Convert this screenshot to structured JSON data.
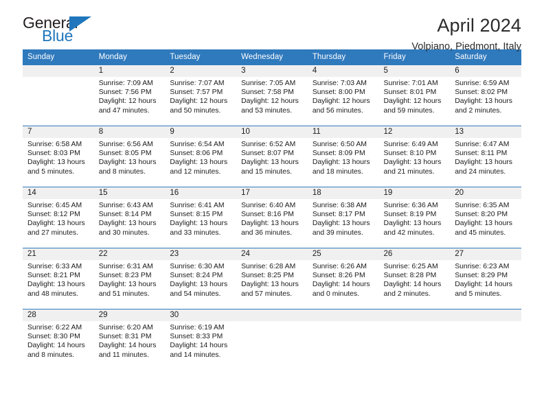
{
  "brand": {
    "name_top": "General",
    "name_bottom": "Blue",
    "triangle_color": "#1f76bc"
  },
  "header": {
    "title": "April 2024",
    "subtitle": "Volpiano, Piedmont, Italy"
  },
  "theme": {
    "header_blue": "#2f79bd",
    "daynum_band": "#f0f0f0",
    "text": "#1a1a1a"
  },
  "calendar": {
    "weekday_headers": [
      "Sunday",
      "Monday",
      "Tuesday",
      "Wednesday",
      "Thursday",
      "Friday",
      "Saturday"
    ],
    "labels": {
      "sunrise": "Sunrise:",
      "sunset": "Sunset:",
      "daylight": "Daylight:"
    },
    "weeks": [
      [
        {
          "day": "",
          "sunrise": "",
          "sunset": "",
          "daylight": ""
        },
        {
          "day": "1",
          "sunrise": "Sunrise: 7:09 AM",
          "sunset": "Sunset: 7:56 PM",
          "daylight": "Daylight: 12 hours and 47 minutes."
        },
        {
          "day": "2",
          "sunrise": "Sunrise: 7:07 AM",
          "sunset": "Sunset: 7:57 PM",
          "daylight": "Daylight: 12 hours and 50 minutes."
        },
        {
          "day": "3",
          "sunrise": "Sunrise: 7:05 AM",
          "sunset": "Sunset: 7:58 PM",
          "daylight": "Daylight: 12 hours and 53 minutes."
        },
        {
          "day": "4",
          "sunrise": "Sunrise: 7:03 AM",
          "sunset": "Sunset: 8:00 PM",
          "daylight": "Daylight: 12 hours and 56 minutes."
        },
        {
          "day": "5",
          "sunrise": "Sunrise: 7:01 AM",
          "sunset": "Sunset: 8:01 PM",
          "daylight": "Daylight: 12 hours and 59 minutes."
        },
        {
          "day": "6",
          "sunrise": "Sunrise: 6:59 AM",
          "sunset": "Sunset: 8:02 PM",
          "daylight": "Daylight: 13 hours and 2 minutes."
        }
      ],
      [
        {
          "day": "7",
          "sunrise": "Sunrise: 6:58 AM",
          "sunset": "Sunset: 8:03 PM",
          "daylight": "Daylight: 13 hours and 5 minutes."
        },
        {
          "day": "8",
          "sunrise": "Sunrise: 6:56 AM",
          "sunset": "Sunset: 8:05 PM",
          "daylight": "Daylight: 13 hours and 8 minutes."
        },
        {
          "day": "9",
          "sunrise": "Sunrise: 6:54 AM",
          "sunset": "Sunset: 8:06 PM",
          "daylight": "Daylight: 13 hours and 12 minutes."
        },
        {
          "day": "10",
          "sunrise": "Sunrise: 6:52 AM",
          "sunset": "Sunset: 8:07 PM",
          "daylight": "Daylight: 13 hours and 15 minutes."
        },
        {
          "day": "11",
          "sunrise": "Sunrise: 6:50 AM",
          "sunset": "Sunset: 8:09 PM",
          "daylight": "Daylight: 13 hours and 18 minutes."
        },
        {
          "day": "12",
          "sunrise": "Sunrise: 6:49 AM",
          "sunset": "Sunset: 8:10 PM",
          "daylight": "Daylight: 13 hours and 21 minutes."
        },
        {
          "day": "13",
          "sunrise": "Sunrise: 6:47 AM",
          "sunset": "Sunset: 8:11 PM",
          "daylight": "Daylight: 13 hours and 24 minutes."
        }
      ],
      [
        {
          "day": "14",
          "sunrise": "Sunrise: 6:45 AM",
          "sunset": "Sunset: 8:12 PM",
          "daylight": "Daylight: 13 hours and 27 minutes."
        },
        {
          "day": "15",
          "sunrise": "Sunrise: 6:43 AM",
          "sunset": "Sunset: 8:14 PM",
          "daylight": "Daylight: 13 hours and 30 minutes."
        },
        {
          "day": "16",
          "sunrise": "Sunrise: 6:41 AM",
          "sunset": "Sunset: 8:15 PM",
          "daylight": "Daylight: 13 hours and 33 minutes."
        },
        {
          "day": "17",
          "sunrise": "Sunrise: 6:40 AM",
          "sunset": "Sunset: 8:16 PM",
          "daylight": "Daylight: 13 hours and 36 minutes."
        },
        {
          "day": "18",
          "sunrise": "Sunrise: 6:38 AM",
          "sunset": "Sunset: 8:17 PM",
          "daylight": "Daylight: 13 hours and 39 minutes."
        },
        {
          "day": "19",
          "sunrise": "Sunrise: 6:36 AM",
          "sunset": "Sunset: 8:19 PM",
          "daylight": "Daylight: 13 hours and 42 minutes."
        },
        {
          "day": "20",
          "sunrise": "Sunrise: 6:35 AM",
          "sunset": "Sunset: 8:20 PM",
          "daylight": "Daylight: 13 hours and 45 minutes."
        }
      ],
      [
        {
          "day": "21",
          "sunrise": "Sunrise: 6:33 AM",
          "sunset": "Sunset: 8:21 PM",
          "daylight": "Daylight: 13 hours and 48 minutes."
        },
        {
          "day": "22",
          "sunrise": "Sunrise: 6:31 AM",
          "sunset": "Sunset: 8:23 PM",
          "daylight": "Daylight: 13 hours and 51 minutes."
        },
        {
          "day": "23",
          "sunrise": "Sunrise: 6:30 AM",
          "sunset": "Sunset: 8:24 PM",
          "daylight": "Daylight: 13 hours and 54 minutes."
        },
        {
          "day": "24",
          "sunrise": "Sunrise: 6:28 AM",
          "sunset": "Sunset: 8:25 PM",
          "daylight": "Daylight: 13 hours and 57 minutes."
        },
        {
          "day": "25",
          "sunrise": "Sunrise: 6:26 AM",
          "sunset": "Sunset: 8:26 PM",
          "daylight": "Daylight: 14 hours and 0 minutes."
        },
        {
          "day": "26",
          "sunrise": "Sunrise: 6:25 AM",
          "sunset": "Sunset: 8:28 PM",
          "daylight": "Daylight: 14 hours and 2 minutes."
        },
        {
          "day": "27",
          "sunrise": "Sunrise: 6:23 AM",
          "sunset": "Sunset: 8:29 PM",
          "daylight": "Daylight: 14 hours and 5 minutes."
        }
      ],
      [
        {
          "day": "28",
          "sunrise": "Sunrise: 6:22 AM",
          "sunset": "Sunset: 8:30 PM",
          "daylight": "Daylight: 14 hours and 8 minutes."
        },
        {
          "day": "29",
          "sunrise": "Sunrise: 6:20 AM",
          "sunset": "Sunset: 8:31 PM",
          "daylight": "Daylight: 14 hours and 11 minutes."
        },
        {
          "day": "30",
          "sunrise": "Sunrise: 6:19 AM",
          "sunset": "Sunset: 8:33 PM",
          "daylight": "Daylight: 14 hours and 14 minutes."
        },
        {
          "day": "",
          "sunrise": "",
          "sunset": "",
          "daylight": ""
        },
        {
          "day": "",
          "sunrise": "",
          "sunset": "",
          "daylight": ""
        },
        {
          "day": "",
          "sunrise": "",
          "sunset": "",
          "daylight": ""
        },
        {
          "day": "",
          "sunrise": "",
          "sunset": "",
          "daylight": ""
        }
      ]
    ]
  }
}
